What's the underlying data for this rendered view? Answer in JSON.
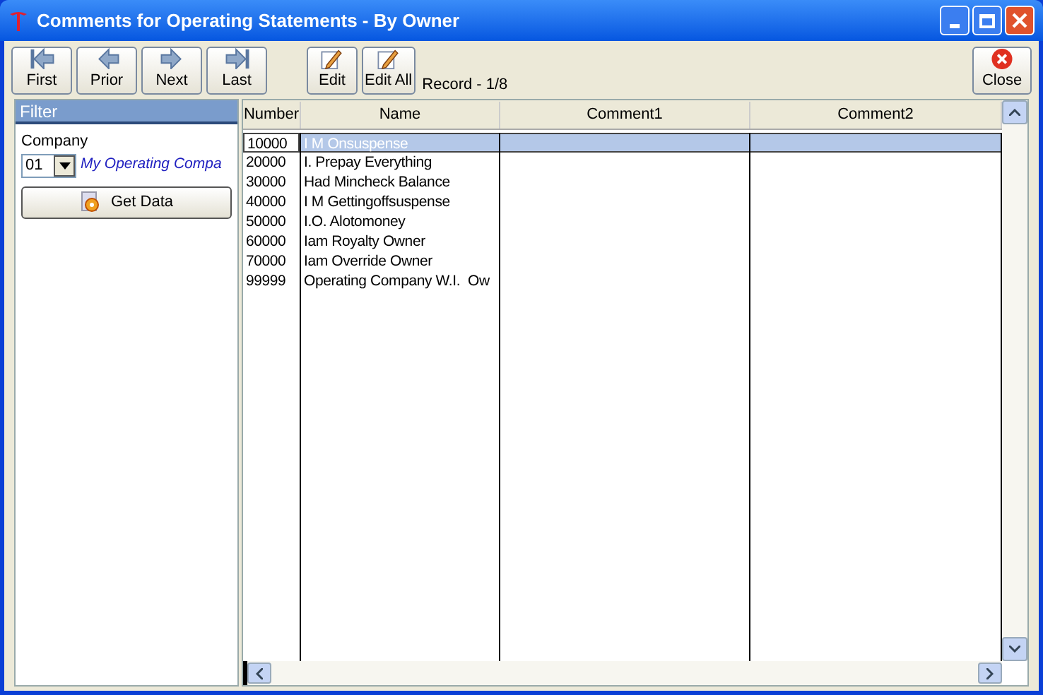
{
  "window": {
    "title": "Comments for Operating Statements - By Owner"
  },
  "toolbar": {
    "nav_buttons": [
      {
        "label": "First",
        "kind": "first"
      },
      {
        "label": "Prior",
        "kind": "prior"
      },
      {
        "label": "Next",
        "kind": "next"
      },
      {
        "label": "Last",
        "kind": "last"
      }
    ],
    "edit_buttons": [
      {
        "label": "Edit"
      },
      {
        "label": "Edit All"
      }
    ],
    "record": "Record - 1/8",
    "close": "Close"
  },
  "filter": {
    "title": "Filter",
    "company_label": "Company",
    "company_code": "01",
    "company_name": "My Operating Compa",
    "get_data": "Get Data"
  },
  "table": {
    "columns": [
      "Number",
      "Name",
      "Comment1",
      "Comment2"
    ],
    "rows": [
      {
        "number": "10000",
        "name": "I M Onsuspense",
        "selected": true
      },
      {
        "number": "20000",
        "name": "I. Prepay Everything",
        "selected": false
      },
      {
        "number": "30000",
        "name": "Had Mincheck Balance",
        "selected": false
      },
      {
        "number": "40000",
        "name": "I M Gettingoffsuspense",
        "selected": false
      },
      {
        "number": "50000",
        "name": "I.O. Alotomoney",
        "selected": false
      },
      {
        "number": "60000",
        "name": "Iam Royalty Owner",
        "selected": false
      },
      {
        "number": "70000",
        "name": "Iam Override Owner",
        "selected": false
      },
      {
        "number": "99999",
        "name": "Operating Company W.I.  Ow",
        "selected": false
      }
    ]
  }
}
